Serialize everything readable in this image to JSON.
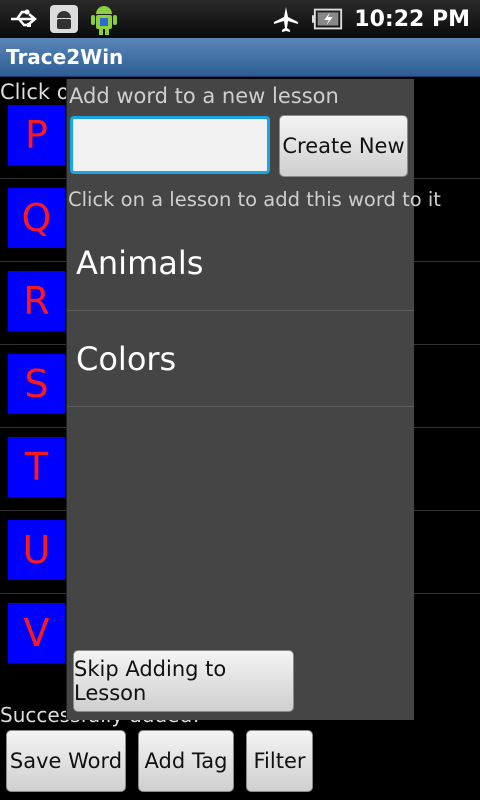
{
  "status_bar": {
    "time": "10:22 PM"
  },
  "app": {
    "title": "Trace2Win"
  },
  "background": {
    "instruction_start": "Click o",
    "instruction_end": "d",
    "letters": [
      "P",
      "Q",
      "R",
      "S",
      "T",
      "U",
      "V"
    ],
    "status_text": "Successfully added!",
    "buttons": {
      "save_word": "Save Word",
      "add_tag": "Add Tag",
      "filter": "Filter"
    }
  },
  "dialog": {
    "new_lesson_label": "Add word to a new lesson",
    "lesson_name_value": "",
    "create_new_label": "Create New",
    "existing_lesson_label": "Click on a lesson to add this word to it",
    "lessons": [
      "Animals",
      "Colors"
    ],
    "skip_label": "Skip Adding to Lesson"
  },
  "colors": {
    "letter_box": "#0000ff",
    "letter": "#ff1a1a",
    "input_focus": "#1aa6e6",
    "titlebar": "#3f6fa5"
  }
}
